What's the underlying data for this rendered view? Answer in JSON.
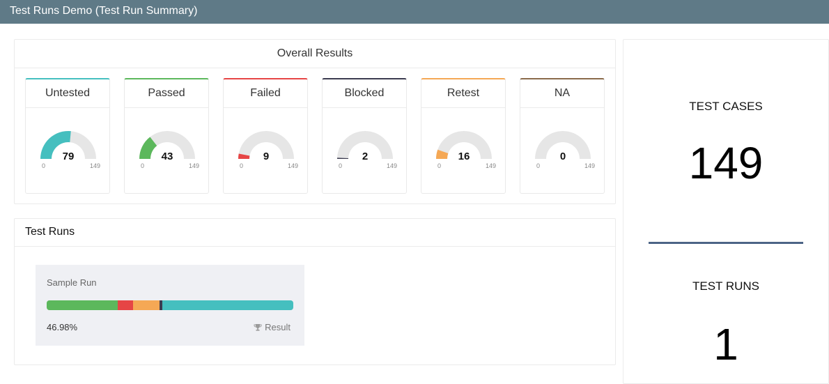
{
  "app": {
    "title": "Test Runs Demo (Test Run Summary)"
  },
  "overall": {
    "header": "Overall Results",
    "total": 149,
    "cards": [
      {
        "label": "Untested",
        "value": 79,
        "min": "0",
        "max": "149",
        "color": "#45bfbf"
      },
      {
        "label": "Passed",
        "value": 43,
        "min": "0",
        "max": "149",
        "color": "#5cb85c"
      },
      {
        "label": "Failed",
        "value": 9,
        "min": "0",
        "max": "149",
        "color": "#e64545"
      },
      {
        "label": "Blocked",
        "value": 2,
        "min": "0",
        "max": "149",
        "color": "#3b3b4f"
      },
      {
        "label": "Retest",
        "value": 16,
        "min": "0",
        "max": "149",
        "color": "#f5a855"
      },
      {
        "label": "NA",
        "value": 0,
        "min": "0",
        "max": "149",
        "color": "#8a6a4a"
      }
    ]
  },
  "test_runs": {
    "header": "Test Runs",
    "runs": [
      {
        "name": "Sample Run",
        "percent": "46.98%",
        "result_label": "Result",
        "result_icon": "trophy-icon",
        "segments": [
          {
            "status": "Passed",
            "value": 43,
            "color": "#5cb85c"
          },
          {
            "status": "Failed",
            "value": 9,
            "color": "#e64545"
          },
          {
            "status": "Retest",
            "value": 16,
            "color": "#f5a855"
          },
          {
            "status": "Blocked",
            "value": 2,
            "color": "#3b3b4f"
          },
          {
            "status": "Untested",
            "value": 79,
            "color": "#45bfbf"
          }
        ]
      }
    ]
  },
  "stats": {
    "test_cases_label": "TEST CASES",
    "test_cases_value": "149",
    "test_runs_label": "TEST RUNS",
    "test_runs_value": "1"
  }
}
